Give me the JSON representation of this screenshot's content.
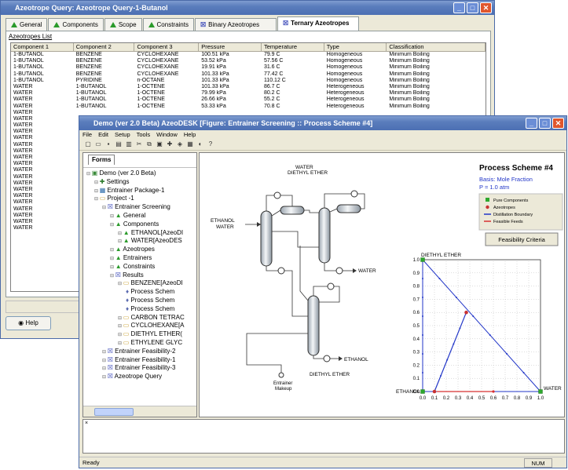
{
  "back_window": {
    "title": "Azeotrope Query: Azeotrope Query-1-Butanol",
    "tabs": [
      "General",
      "Components",
      "Scope",
      "Constraints",
      "Binary Azeotropes",
      "Ternary Azeotropes"
    ],
    "group_label": "Azeotropes List",
    "columns": [
      "Component 1",
      "Component 2",
      "Component 3",
      "Pressure",
      "Temperature",
      "Type",
      "Classification"
    ],
    "rows": [
      [
        "1-BUTANOL",
        "BENZENE",
        "CYCLOHEXANE",
        "100.51 kPa",
        "79.9 C",
        "Homogeneous",
        "Minimum Boiling"
      ],
      [
        "1-BUTANOL",
        "BENZENE",
        "CYCLOHEXANE",
        "53.52 kPa",
        "57.56 C",
        "Homogeneous",
        "Minimum Boiling"
      ],
      [
        "1-BUTANOL",
        "BENZENE",
        "CYCLOHEXANE",
        "19.91 kPa",
        "31.6 C",
        "Homogeneous",
        "Minimum Boiling"
      ],
      [
        "1-BUTANOL",
        "BENZENE",
        "CYCLOHEXANE",
        "101.33 kPa",
        "77.42 C",
        "Homogeneous",
        "Minimum Boiling"
      ],
      [
        "1-BUTANOL",
        "PYRIDINE",
        "n-OCTANE",
        "101.33 kPa",
        "110.12 C",
        "Homogeneous",
        "Minimum Boiling"
      ],
      [
        "WATER",
        "1-BUTANOL",
        "1-OCTENE",
        "101.33 kPa",
        "86.7 C",
        "Heterogeneous",
        "Minimum Boiling"
      ],
      [
        "WATER",
        "1-BUTANOL",
        "1-OCTENE",
        "79.99 kPa",
        "80.2 C",
        "Heterogeneous",
        "Minimum Boiling"
      ],
      [
        "WATER",
        "1-BUTANOL",
        "1-OCTENE",
        "26.66 kPa",
        "55.2 C",
        "Heterogeneous",
        "Minimum Boiling"
      ],
      [
        "WATER",
        "1-BUTANOL",
        "1-OCTENE",
        "53.33 kPa",
        "70.8 C",
        "Heterogeneous",
        "Minimum Boiling"
      ]
    ],
    "extra_rows_col1": [
      "WATER",
      "WATER",
      "WATER",
      "WATER",
      "WATER",
      "WATER",
      "WATER",
      "WATER",
      "WATER",
      "WATER",
      "WATER",
      "WATER",
      "WATER",
      "WATER",
      "WATER",
      "WATER",
      "WATER",
      "WATER",
      "WATER"
    ],
    "help_label": "Help"
  },
  "front_window": {
    "title": "Demo (ver 2.0 Beta)  AzeoDESK  [Figure: Entrainer Screening :: Process Scheme #4]",
    "menu": [
      "File",
      "Edit",
      "Setup",
      "Tools",
      "Window",
      "Help"
    ],
    "forms_tab": "Forms",
    "tree": [
      {
        "label": "Demo (ver 2.0 Beta)",
        "level": 0
      },
      {
        "label": "Settings",
        "level": 1
      },
      {
        "label": "Entrainer Package-1",
        "level": 1
      },
      {
        "label": "Project -1",
        "level": 1
      },
      {
        "label": "Entrainer Screening",
        "level": 2
      },
      {
        "label": "General",
        "level": 3
      },
      {
        "label": "Components",
        "level": 3
      },
      {
        "label": "ETHANOL[AzeoDI",
        "level": 4
      },
      {
        "label": "WATER[AzeoDES",
        "level": 4
      },
      {
        "label": "Azeotropes",
        "level": 3
      },
      {
        "label": "Entrainers",
        "level": 3
      },
      {
        "label": "Constraints",
        "level": 3
      },
      {
        "label": "Results",
        "level": 3
      },
      {
        "label": "BENZENE[AzeoDI",
        "level": 4
      },
      {
        "label": "Process Schem",
        "level": 5
      },
      {
        "label": "Process Schem",
        "level": 5
      },
      {
        "label": "Process Schem",
        "level": 5
      },
      {
        "label": "CARBON TETRAC",
        "level": 4
      },
      {
        "label": "CYCLOHEXANE[A",
        "level": 4
      },
      {
        "label": "DIETHYL ETHER(",
        "level": 4
      },
      {
        "label": "ETHYLENE GLYC",
        "level": 4
      },
      {
        "label": "Entrainer Feasibility-2",
        "level": 2
      },
      {
        "label": "Entrainer Feasibility-1",
        "level": 2
      },
      {
        "label": "Entrainer Feasibility-3",
        "level": 2
      },
      {
        "label": "Azeotrope Query",
        "level": 2
      }
    ],
    "scheme": {
      "title": "Process Scheme #4",
      "basis": "Basis: Mole Fraction",
      "pressure": "P = 1.0 atm",
      "legend": [
        "Pure Components",
        "Azeotropes",
        "Distillation Boundary",
        "Feasible Feeds"
      ],
      "feasibility_button": "Feasibility Criteria",
      "labels": {
        "water_top": "WATER",
        "diethyl_top": "DIETHYL ETHER",
        "ethanol_feed": "ETHANOL",
        "water_feed": "WATER",
        "water_out": "WATER",
        "ethanol_out": "ETHANOL",
        "diethyl_bottom": "DIETHYL ETHER",
        "entrainer": "Entrainer",
        "makeup": "Makeup"
      }
    },
    "status": "Ready",
    "num": "NUM",
    "colors": {
      "pure": "#2ea82e",
      "azeo": "#c83232",
      "boundary": "#2236c8",
      "feeds": "#d83030"
    }
  },
  "chart_data": {
    "type": "scatter",
    "title": "",
    "axis_top_label": "DIETHYL ETHER",
    "axis_left_label": "ETHANOL",
    "axis_right_label": "WATER",
    "x_ticks": [
      "0.0",
      "0.1",
      "0.2",
      "0.3",
      "0.4",
      "0.5",
      "0.6",
      "0.7",
      "0.8",
      "0.9",
      "1.0"
    ],
    "y_ticks": [
      "0.0",
      "0.1",
      "0.2",
      "0.3",
      "0.4",
      "0.5",
      "0.6",
      "0.7",
      "0.8",
      "0.9",
      "1.0"
    ],
    "pure_components": [
      [
        0,
        1
      ],
      [
        0,
        0
      ],
      [
        1,
        0
      ]
    ],
    "azeotropes": [
      [
        0.1,
        0
      ],
      [
        0.37,
        0.6
      ]
    ],
    "boundary": [
      [
        0.1,
        0
      ],
      [
        0.37,
        0.6
      ]
    ],
    "feasible_feeds": [
      [
        0.6,
        0
      ]
    ],
    "grid": true
  }
}
